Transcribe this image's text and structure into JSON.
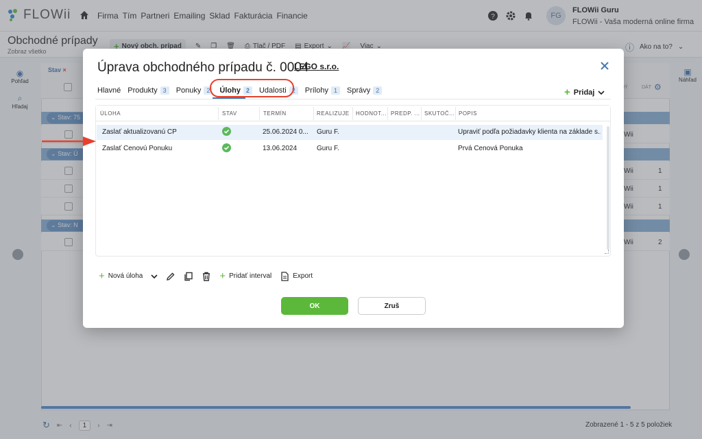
{
  "app": {
    "brand": "FLOWii",
    "menu": [
      "Firma",
      "Tím",
      "Partneri",
      "Emailing",
      "Sklad",
      "Fakturácia",
      "Financie"
    ],
    "user": {
      "initials": "FG",
      "name": "FLOWii Guru",
      "subtitle": "FLOWii - Vaša moderná online firma"
    }
  },
  "page": {
    "title": "Obchodné prípady",
    "subtitle": "Zobraz všetko",
    "toolbar": {
      "new_case": "Nový obch. prípad",
      "print": "Tlač / PDF",
      "export": "Export",
      "more": "Viac"
    },
    "how_to": "Ako na to?",
    "left_rail": {
      "view": "Pohľad",
      "search": "Hľadaj"
    },
    "right_rail": {
      "preview": "Náhľad"
    },
    "filter": {
      "stav": "Stav"
    },
    "group_labels": [
      "Stav: 75",
      "Stav: Ú",
      "Stav: N"
    ],
    "bg_fragments": {
      "a": "Wii",
      "b": "Wii",
      "c": "Wii",
      "d": "Wii",
      "e": "Wii",
      "n1": "1",
      "n2": "1",
      "n3": "1",
      "n4": "2"
    },
    "header_fragments": {
      "h1": "NÝ",
      "h2": "DÁT"
    },
    "pager": {
      "current": "1"
    },
    "count_text": "Zobrazené 1 - 5 z 5 položiek"
  },
  "modal": {
    "title": "Úprava obchodného prípadu č. 0004",
    "company": "LEGO s.r.o.",
    "tabs": [
      {
        "label": "Hlavné",
        "badge": ""
      },
      {
        "label": "Produkty",
        "badge": "3"
      },
      {
        "label": "Ponuky",
        "badge": "2"
      },
      {
        "label": "Úlohy",
        "badge": "2"
      },
      {
        "label": "Udalosti",
        "badge": "2"
      },
      {
        "label": "Prílohy",
        "badge": "1"
      },
      {
        "label": "Správy",
        "badge": "2"
      }
    ],
    "add_label": "Pridaj",
    "columns": [
      "ÚLOHA",
      "STAV",
      "TERMÍN",
      "REALIZUJE",
      "HODNOT...",
      "PREDP. ...",
      "SKUTOČ...",
      "POPIS"
    ],
    "rows": [
      {
        "task": "Zaslať aktualizovanú CP",
        "done": true,
        "date": "25.06.2024 0...",
        "assignee": "Guru F.",
        "description": "Upraviť podľa požiadavky klienta na základe s..."
      },
      {
        "task": "Zaslať Cenovú Ponuku",
        "done": true,
        "date": "13.06.2024",
        "assignee": "Guru F.",
        "description": "Prvá Cenová Ponuka"
      }
    ],
    "actions": {
      "new_task": "Nová úloha",
      "add_interval": "Pridať interval",
      "export": "Export"
    },
    "ok": "OK",
    "cancel": "Zruš"
  },
  "colors": {
    "accent_green": "#5cb83a",
    "accent_blue": "#4a78b4",
    "highlight_red": "#e8402d",
    "status_done": "#5cb85c"
  }
}
